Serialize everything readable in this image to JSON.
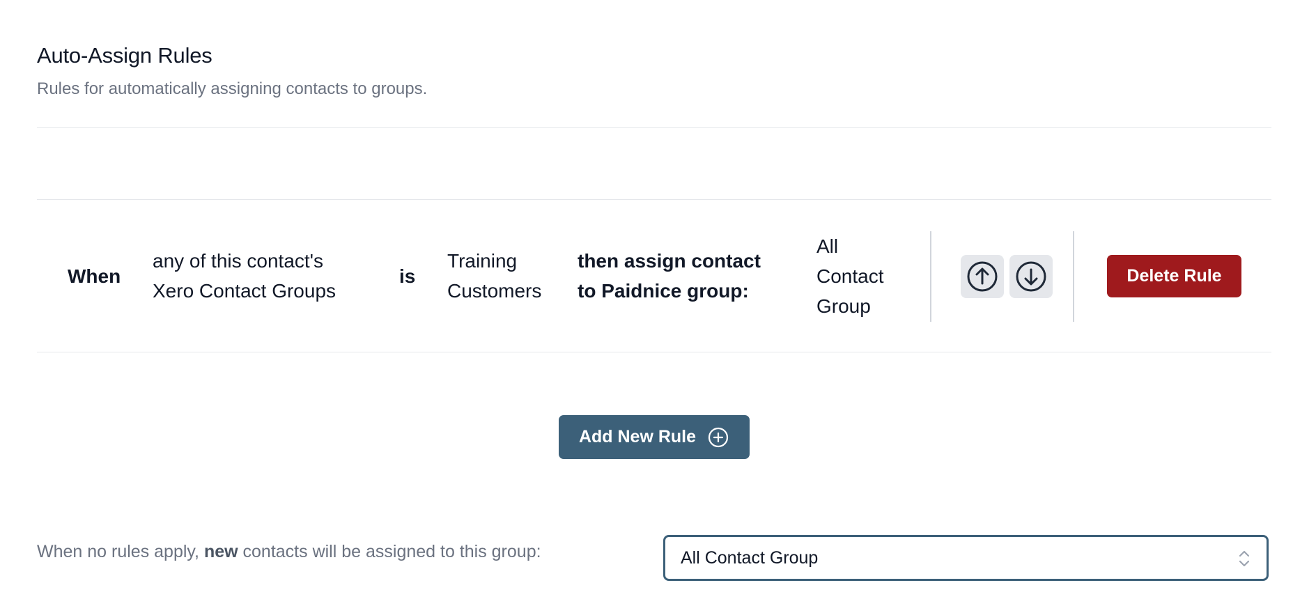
{
  "section": {
    "title": "Auto-Assign Rules",
    "subtitle": "Rules for automatically assigning contacts to groups."
  },
  "rule": {
    "when_label": "When",
    "field_line1": "any of this contact's",
    "field_line2": "Xero Contact Groups",
    "operator": "is",
    "value_line1": "Training",
    "value_line2": "Customers",
    "then_line1": "then assign contact",
    "then_line2": "to Paidnice group:",
    "group_line1": "All",
    "group_line2": "Contact",
    "group_line3": "Group",
    "move_up_icon": "arrow-up-circle-icon",
    "move_down_icon": "arrow-down-circle-icon",
    "delete_label": "Delete Rule"
  },
  "actions": {
    "add_rule_label": "Add New Rule",
    "add_rule_icon": "plus-circle-icon"
  },
  "default_group": {
    "text_before": "When no rules apply, ",
    "text_bold": "new",
    "text_after": " contacts will be assigned to this group:",
    "selected": "All Contact Group"
  },
  "colors": {
    "primary": "#3c6079",
    "danger": "#9f1a1d"
  }
}
